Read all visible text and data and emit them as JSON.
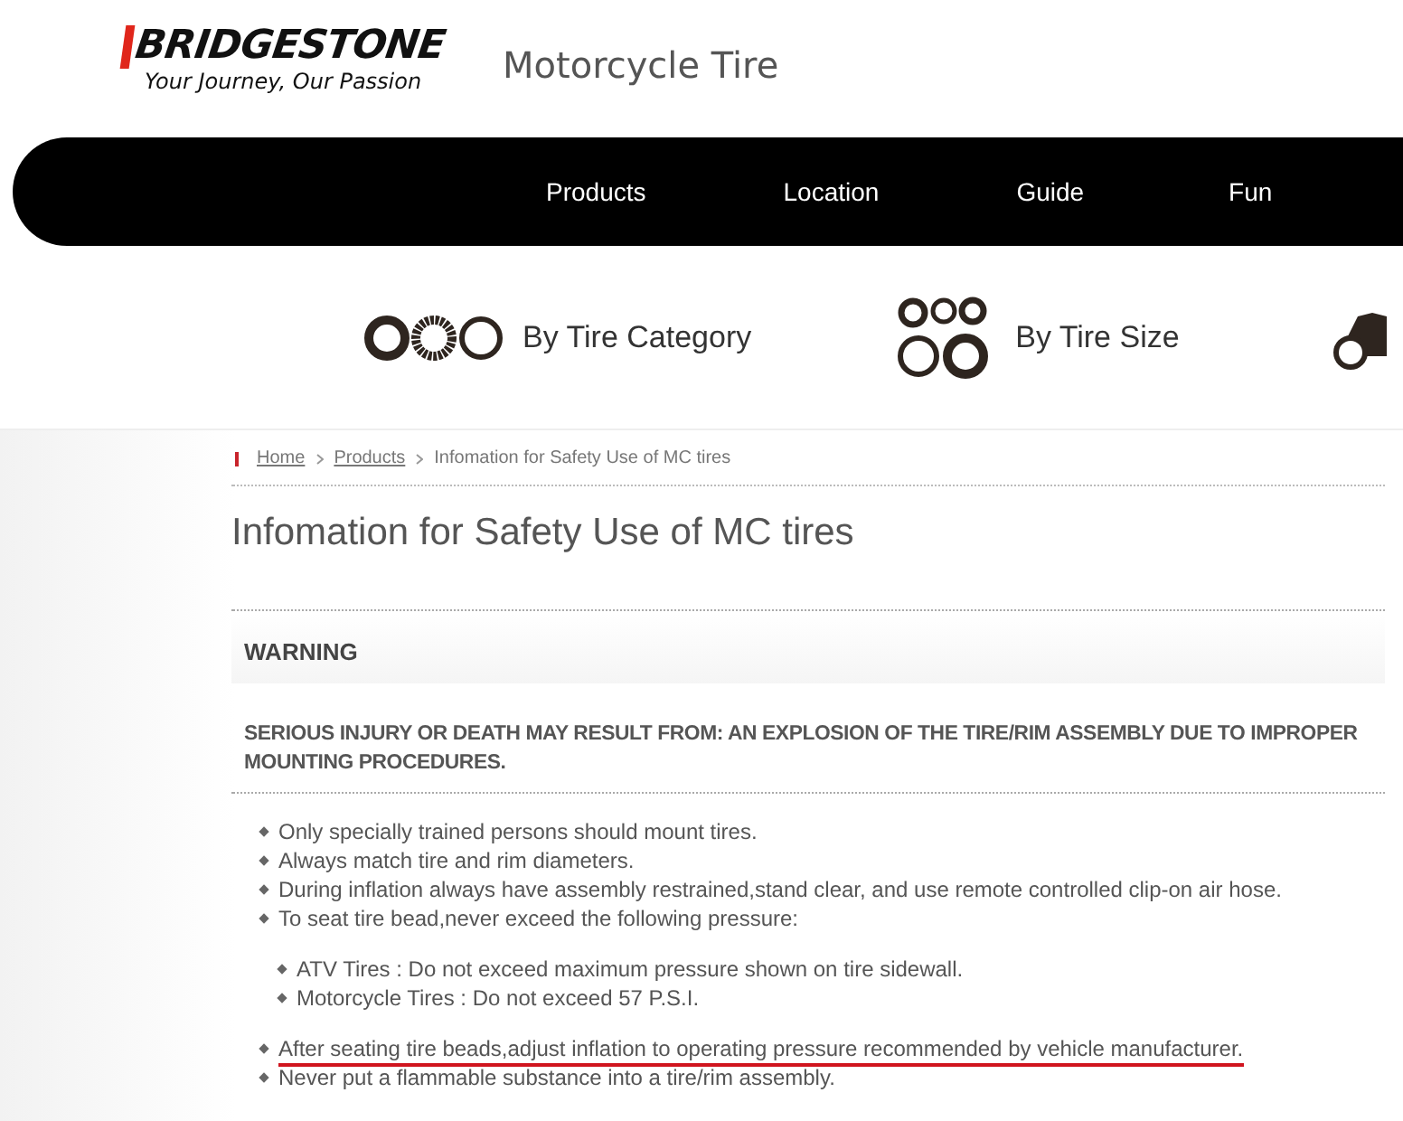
{
  "header": {
    "brand": "BRIDGESTONE",
    "tagline": "Your Journey, Our Passion",
    "site_title": "Motorcycle Tire"
  },
  "nav": [
    {
      "label": "Products"
    },
    {
      "label": "Location"
    },
    {
      "label": "Guide"
    },
    {
      "label": "Fun"
    }
  ],
  "categories": [
    {
      "kind": "category",
      "label": "By Tire Category"
    },
    {
      "kind": "size",
      "label": "By Tire Size"
    },
    {
      "kind": "bike"
    }
  ],
  "breadcrumb": [
    {
      "label": "Home",
      "link": true
    },
    {
      "label": "Products",
      "link": true
    },
    {
      "label": "Infomation for Safety Use of MC tires",
      "link": false
    }
  ],
  "page_title": "Infomation for Safety Use of MC tires",
  "warning": {
    "heading": "WARNING",
    "statement": "SERIOUS INJURY OR DEATH MAY RESULT FROM: AN EXPLOSION OF THE TIRE/RIM ASSEMBLY DUE TO IMPROPER MOUNTING PROCEDURES.",
    "items": [
      {
        "text": "Only specially trained persons should mount tires.",
        "highlighted": false
      },
      {
        "text": "Always match tire and rim diameters.",
        "highlighted": false
      },
      {
        "text": "During inflation always have assembly restrained,stand clear, and use remote controlled clip-on air hose.",
        "highlighted": false
      },
      {
        "text": "To seat tire bead,never exceed the following pressure:",
        "highlighted": false,
        "children": [
          {
            "text": "ATV Tires : Do not exceed maximum pressure shown on tire sidewall.",
            "highlighted": false
          },
          {
            "text": "Motorcycle Tires : Do not exceed 57 P.S.I.",
            "highlighted": false
          }
        ]
      },
      {
        "text": "After seating tire beads,adjust inflation to operating pressure recommended by vehicle manufacturer.",
        "highlighted": true
      },
      {
        "text": "Never put a flammable substance into a tire/rim assembly.",
        "highlighted": false
      }
    ]
  }
}
